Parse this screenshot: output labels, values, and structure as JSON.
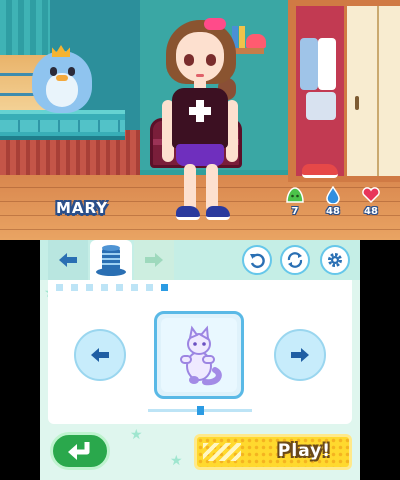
{
  "top_screen": {
    "character_name": "MARY",
    "stats": [
      {
        "icon": "green-slime-icon",
        "value": "7",
        "color": "#4cc24a"
      },
      {
        "icon": "water-drop-icon",
        "value": "48",
        "color": "#2f8fe0"
      },
      {
        "icon": "heart-icon",
        "value": "48",
        "color": "#e8355a"
      }
    ]
  },
  "bottom_screen": {
    "tabs": [
      {
        "name": "tab-back",
        "icon": "left-arrow-icon"
      },
      {
        "name": "tab-hat",
        "icon": "top-hat-icon",
        "active": true
      },
      {
        "name": "tab-forward",
        "icon": "right-arrow-icon"
      }
    ],
    "toolbar_buttons": [
      "undo-icon",
      "refresh-icon",
      "settings-gear-icon"
    ],
    "page_count": 8,
    "page_selected": 8,
    "item": {
      "icon": "cat-plush-icon"
    },
    "slider": {
      "position": 0.5
    },
    "return_button": {
      "icon": "return-arrow-icon"
    },
    "play_button": {
      "label": "Play!"
    },
    "colors": {
      "accent": "#2b9be3",
      "panel": "#ffffff",
      "play": "#ffd92e",
      "return": "#2aa84c"
    }
  }
}
